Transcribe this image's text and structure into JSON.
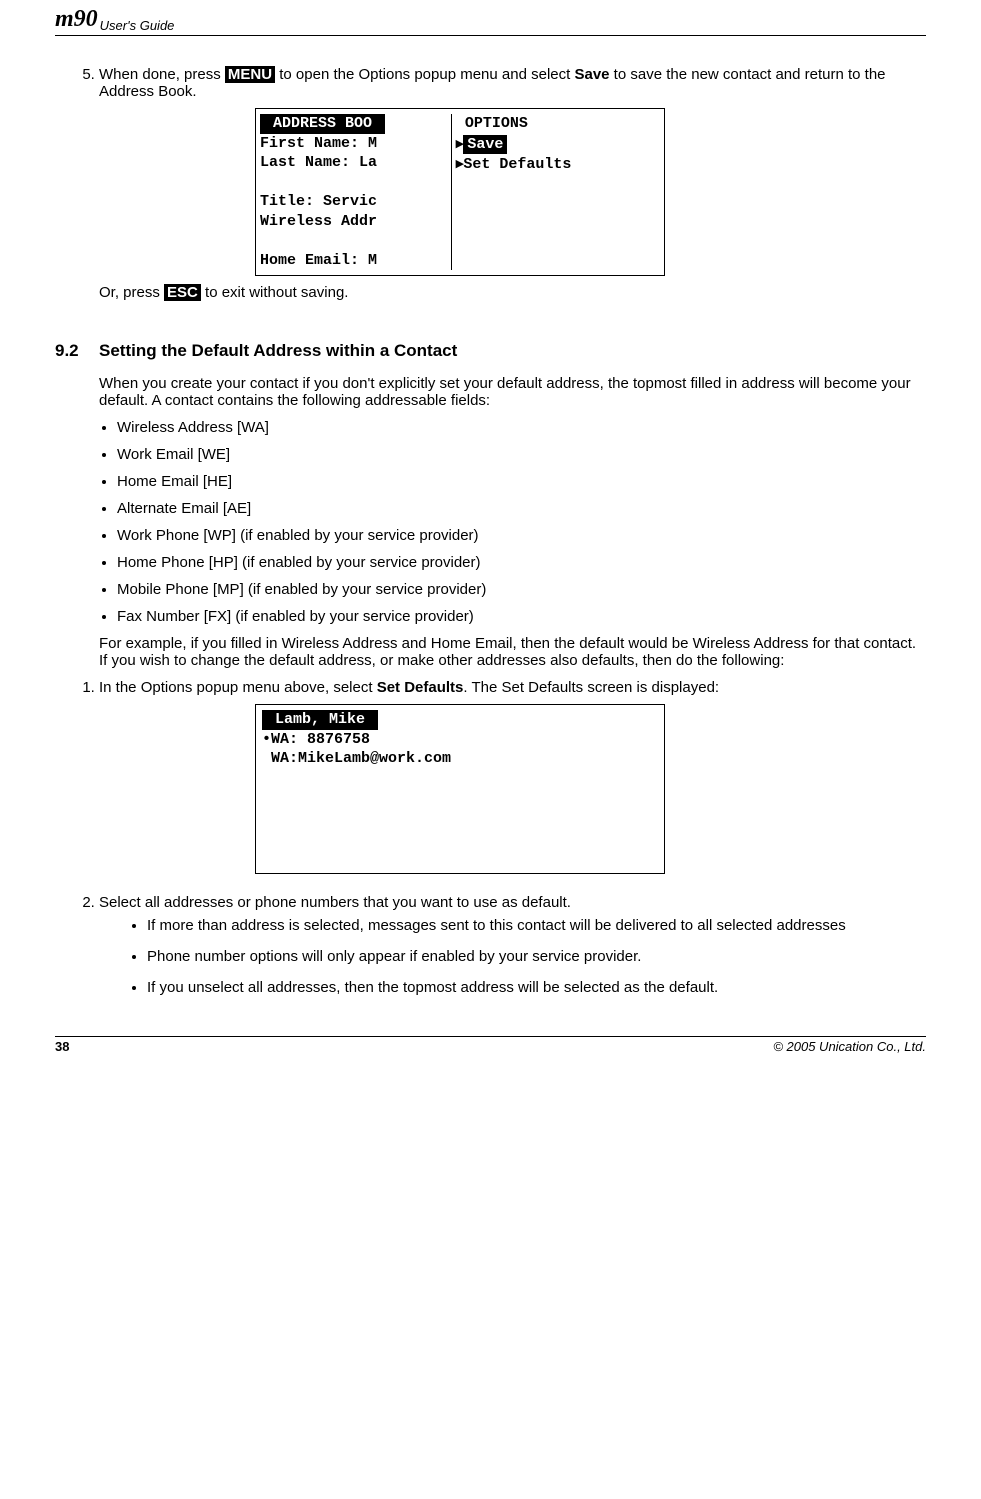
{
  "header": {
    "logo": "m90",
    "guide": "User's Guide"
  },
  "footer": {
    "page": "38",
    "copyright": "© 2005 Unication Co., Ltd."
  },
  "step5": {
    "pre": "When done, press ",
    "menu": "MENU",
    "mid": " to open the Options popup menu and select ",
    "save": "Save",
    "post": " to save the new contact and return to the Address Book."
  },
  "screen1": {
    "left_title": "ADDRESS BOO",
    "l1": "First Name: M",
    "l2": "Last Name: La",
    "l3": " ",
    "l4": "Title: Servic",
    "l5": "Wireless Addr",
    "l6": " ",
    "l7": "Home Email: M",
    "right_title": " OPTIONS",
    "opt1": "Save",
    "opt2": "Set Defaults"
  },
  "or_press": {
    "pre": "Or, press ",
    "esc": "ESC",
    "post": " to exit without saving."
  },
  "section92": {
    "num": "9.2",
    "title": "Setting the Default Address within a Contact",
    "intro": "When you create your contact if you don't explicitly set your default address, the topmost filled in address will become your default. A contact contains the following addressable fields:",
    "items": [
      "Wireless Address [WA]",
      "Work Email [WE]",
      "Home Email [HE]",
      "Alternate Email [AE]",
      "Work Phone [WP] (if enabled by your service provider)",
      "Home Phone [HP] (if enabled by your service provider)",
      "Mobile Phone [MP] (if enabled by your service provider)",
      "Fax Number [FX] (if enabled by your service provider)"
    ],
    "example": "For example, if you filled in Wireless Address and Home Email, then the default would be Wireless Address for that contact. If you wish to change the default address, or make other addresses also defaults, then do the following:"
  },
  "step1b": {
    "pre": "In the Options popup menu above, select ",
    "sel": "Set Defaults",
    "post": ". The Set Defaults screen is displayed:"
  },
  "screen2": {
    "title": " Lamb, Mike ",
    "l1": "•WA: 8876758",
    "l2": " WA:MikeLamb@work.com"
  },
  "step2b": {
    "text": "Select all addresses or phone numbers that you want to use as default.",
    "sub": [
      "If more than address is selected, messages sent to this contact will be delivered to all selected addresses",
      "Phone number options will only appear if enabled by your service provider.",
      "If you unselect all addresses, then the topmost address will be selected as the default."
    ]
  }
}
